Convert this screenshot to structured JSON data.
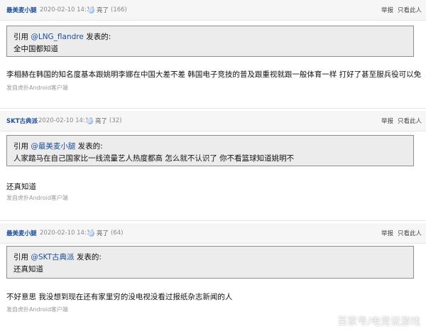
{
  "posts": [
    {
      "author": "最美麦小腿",
      "time": "2020-02-10 14:18",
      "light_label": "亮了",
      "light_count": "(166)",
      "report": "举报",
      "only_author": "只看此人",
      "quote_prefix": "引用 ",
      "quote_user": "@LNG_flandre",
      "quote_suffix": " 发表的:",
      "quote_text": "全中国都知道",
      "content": "李相赫在韩国的知名度基本跟姚明李娜在中国大差不差 韩国电子竞技的普及跟重视就跟一般体育一样 打好了甚至服兵役可以免",
      "source": "发自虎扑Android客户端"
    },
    {
      "author": "SKT古典派",
      "time": "2020-02-10 14:13",
      "light_label": "亮了",
      "light_count": "(32)",
      "report": "举报",
      "only_author": "只看此人",
      "quote_prefix": "引用 ",
      "quote_user": "@最美麦小腿",
      "quote_suffix": " 发表的:",
      "quote_text": "人家踏马在自己国家比一线流量艺人热度都高 怎么就不认识了 你不看篮球知道姚明不",
      "content": "还真知道",
      "source": "发自虎扑Android客户端"
    },
    {
      "author": "最美麦小腿",
      "time": "2020-02-10 14:15",
      "light_label": "亮了",
      "light_count": "(64)",
      "report": "举报",
      "only_author": "只看此人",
      "quote_prefix": "引用 ",
      "quote_user": "@SKT古典派",
      "quote_suffix": " 发表的:",
      "quote_text": "还真知道",
      "content": "不好意思 我没想到现在还有家里穷的没电视没看过报纸杂志新闻的人",
      "source": "发自虎扑Android客户端"
    }
  ],
  "watermark": "百家号/电竞说游戏"
}
